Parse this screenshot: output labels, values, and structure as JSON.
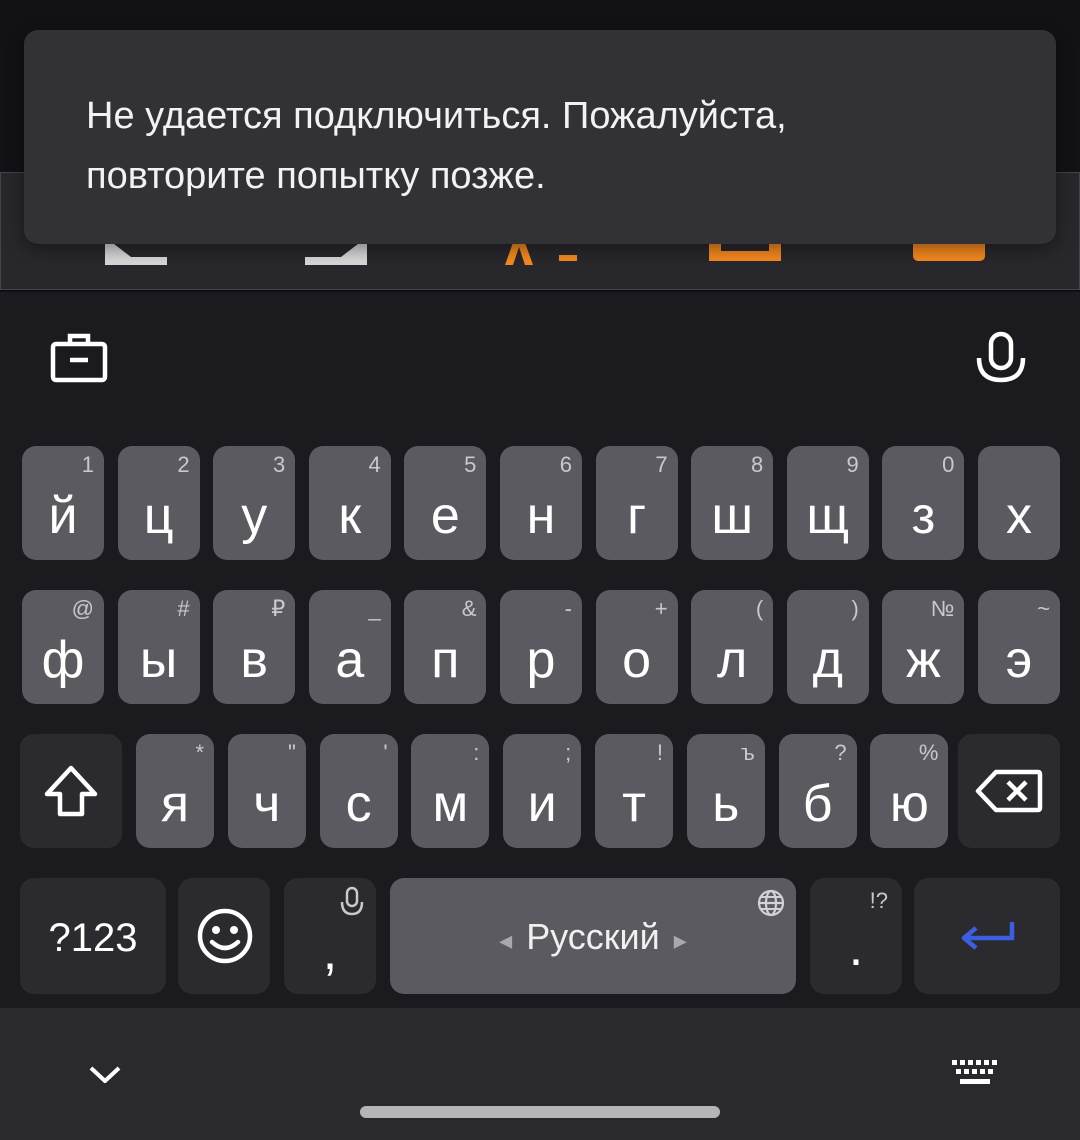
{
  "toast": {
    "message_line1": "Не удается подключиться. Пожалуйста,",
    "message_line2": "повторите попытку позже."
  },
  "colors": {
    "accent_orange": "#f5891f",
    "key_light": "#5b5a60",
    "key_dark": "#2b2a2f",
    "keyboard_bg": "#1b1a1f",
    "enter_blue": "#3b5fe0"
  },
  "keyboard": {
    "toolbar": {
      "left_icon": "briefcase-icon",
      "right_icon": "microphone-icon"
    },
    "row1": [
      {
        "main": "й",
        "hint": "1"
      },
      {
        "main": "ц",
        "hint": "2"
      },
      {
        "main": "у",
        "hint": "3"
      },
      {
        "main": "к",
        "hint": "4"
      },
      {
        "main": "е",
        "hint": "5"
      },
      {
        "main": "н",
        "hint": "6"
      },
      {
        "main": "г",
        "hint": "7"
      },
      {
        "main": "ш",
        "hint": "8"
      },
      {
        "main": "щ",
        "hint": "9"
      },
      {
        "main": "з",
        "hint": "0"
      },
      {
        "main": "х",
        "hint": ""
      }
    ],
    "row2": [
      {
        "main": "ф",
        "hint": "@"
      },
      {
        "main": "ы",
        "hint": "#"
      },
      {
        "main": "в",
        "hint": "₽"
      },
      {
        "main": "а",
        "hint": "_"
      },
      {
        "main": "п",
        "hint": "&"
      },
      {
        "main": "р",
        "hint": "-"
      },
      {
        "main": "о",
        "hint": "+"
      },
      {
        "main": "л",
        "hint": "("
      },
      {
        "main": "д",
        "hint": ")"
      },
      {
        "main": "ж",
        "hint": "№"
      },
      {
        "main": "э",
        "hint": "~"
      }
    ],
    "row3": [
      {
        "main": "я",
        "hint": "*"
      },
      {
        "main": "ч",
        "hint": "\""
      },
      {
        "main": "с",
        "hint": "'"
      },
      {
        "main": "м",
        "hint": ":"
      },
      {
        "main": "и",
        "hint": ";"
      },
      {
        "main": "т",
        "hint": "!"
      },
      {
        "main": "ь",
        "hint": "ъ"
      },
      {
        "main": "б",
        "hint": "?"
      },
      {
        "main": "ю",
        "hint": "%"
      }
    ],
    "symbols_label": "?123",
    "comma_label": ",",
    "space_label": "Русский",
    "space_left_arrow": "◂",
    "space_right_arrow": "▸",
    "period_label": ".",
    "period_hint": "!?"
  }
}
